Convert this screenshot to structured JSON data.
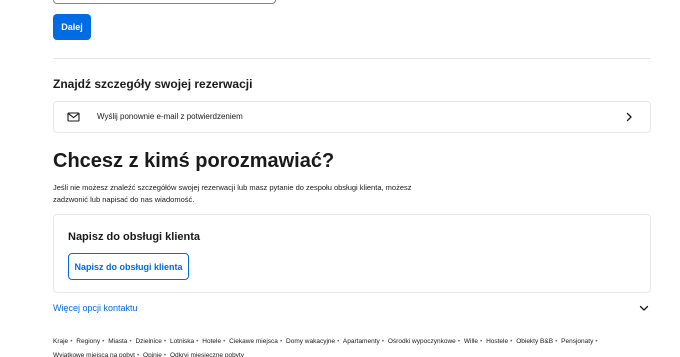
{
  "form": {
    "next_button": "Dalej"
  },
  "booking_details": {
    "title": "Znajdź szczegóły swojej rezerwacji",
    "resend_icon": "mail-icon",
    "resend_label": "Wyślij ponownie e-mail z potwierdzeniem"
  },
  "talk": {
    "title": "Chcesz z kimś porozmawiać?",
    "description": "Jeśli nie możesz znaleźć szczegółów swojej rezerwacji lub masz pytanie do zespołu obsługi klienta, możesz zadzwonić lub napisać do nas wiadomość."
  },
  "contact_card": {
    "title": "Napisz do obsługi klienta",
    "button": "Napisz do obsługi klienta"
  },
  "more_options": {
    "label": "Więcej opcji kontaktu"
  },
  "footer": {
    "links": [
      "Kraje",
      "Regiony",
      "Miasta",
      "Dzielnice",
      "Lotniska",
      "Hotele",
      "Ciekawe miejsca",
      "Domy wakacyjne",
      "Apartamenty",
      "Ośrodki wypoczynkowe",
      "Wille",
      "Hostele",
      "Obiekty B&B",
      "Pensjonaty",
      "Wyjątkowe miejsca na pobyt",
      "Opinie",
      "Odkryj miesięczne pobyty"
    ],
    "separator": "•"
  },
  "colors": {
    "accent": "#006ce4",
    "text": "#1a1a1a",
    "border": "#e7e7e7"
  }
}
